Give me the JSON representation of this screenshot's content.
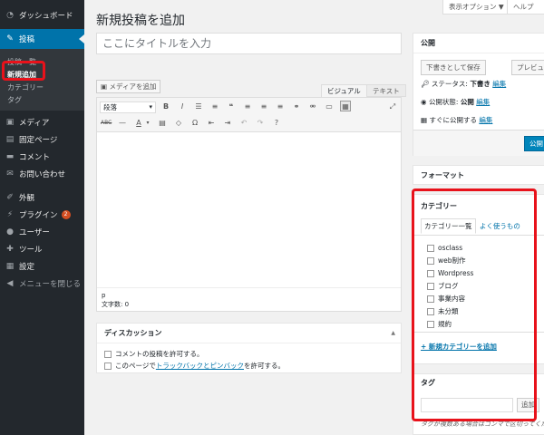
{
  "sidebar": {
    "dashboard": "ダッシュボード",
    "posts": "投稿",
    "posts_sub": [
      "投稿一覧",
      "新規追加",
      "カテゴリー",
      "タグ"
    ],
    "items": [
      "メディア",
      "固定ページ",
      "コメント",
      "お問い合わせ"
    ],
    "items2": [
      "外観",
      "プラグイン",
      "ユーザー",
      "ツール",
      "設定"
    ],
    "plugin_badge": "2",
    "collapse": "メニューを閉じる"
  },
  "topbar": {
    "screen_options": "表示オプション ▼",
    "help": "ヘルプ"
  },
  "page": {
    "title": "新規投稿を追加",
    "title_placeholder": "ここにタイトルを入力"
  },
  "editor": {
    "add_media": "メディアを追加",
    "tab_visual": "ビジュアル",
    "tab_text": "テキスト",
    "format": "段落",
    "path": "p",
    "word_count": "文字数: 0"
  },
  "discussion": {
    "title": "ディスカッション",
    "opt1": "コメントの投稿を許可する。",
    "opt2_pre": "このページで",
    "opt2_link": "トラックバックとピンバック",
    "opt2_post": "を許可する。"
  },
  "publish": {
    "title": "公開",
    "save_draft": "下書きとして保存",
    "preview": "プレビュー",
    "status_label": "ステータス:",
    "status_value": "下書き",
    "visibility_label": "公開状態:",
    "visibility_value": "公開",
    "schedule_label": "すぐに公開する",
    "edit": "編集",
    "publish_btn": "公開"
  },
  "format_box": {
    "title": "フォーマット"
  },
  "categories": {
    "title": "カテゴリー",
    "tab_all": "カテゴリー一覧",
    "tab_popular": "よく使うもの",
    "items": [
      "osclass",
      "web制作",
      "Wordpress",
      "ブログ",
      "事業内容",
      "未分類",
      "規約"
    ],
    "add_new": "+ 新規カテゴリーを追加"
  },
  "tags": {
    "title": "タグ",
    "add_btn": "追加",
    "hint": "タグが複数ある場合はコンマで区切ってください"
  }
}
